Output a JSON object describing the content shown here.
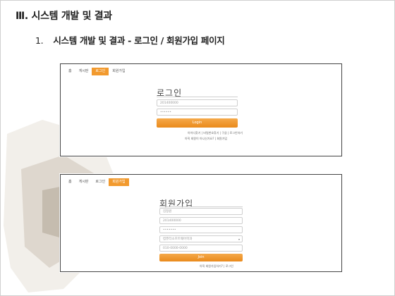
{
  "slide": {
    "heading": "Ⅲ. 시스템 개발 및 결과",
    "subheading_number": "1.",
    "subheading_text": "시스템 개발 및 결과  - 로그인 / 회원가입 페이지"
  },
  "login_screen": {
    "nav": [
      "홈",
      "게시판",
      "로그인",
      "회원가입"
    ],
    "active_nav_index": 2,
    "title": "로그인",
    "id_value": "201400000",
    "password_value": "••••••",
    "button_label": "Login",
    "link_row1": "아이디찾기 | 비밀번호찾기 | 구글 | 로그인하기",
    "link_row2": "아직 회원이 아니신가요? | 회원가입"
  },
  "join_screen": {
    "nav": [
      "홈",
      "게시판",
      "로그인",
      "회원가입"
    ],
    "active_nav_index": 3,
    "title": "회원가입",
    "name_value": "김정원",
    "id_value": "201400000",
    "password_value": "•••••••",
    "department_value": "컴퓨터소프트웨어학과",
    "phone_value": "010-0000-0000",
    "button_label": "Join",
    "footer_link": "아직 회원가입하기? | 로그인"
  },
  "colors": {
    "accent": "#f29a2e",
    "border": "#444444"
  }
}
